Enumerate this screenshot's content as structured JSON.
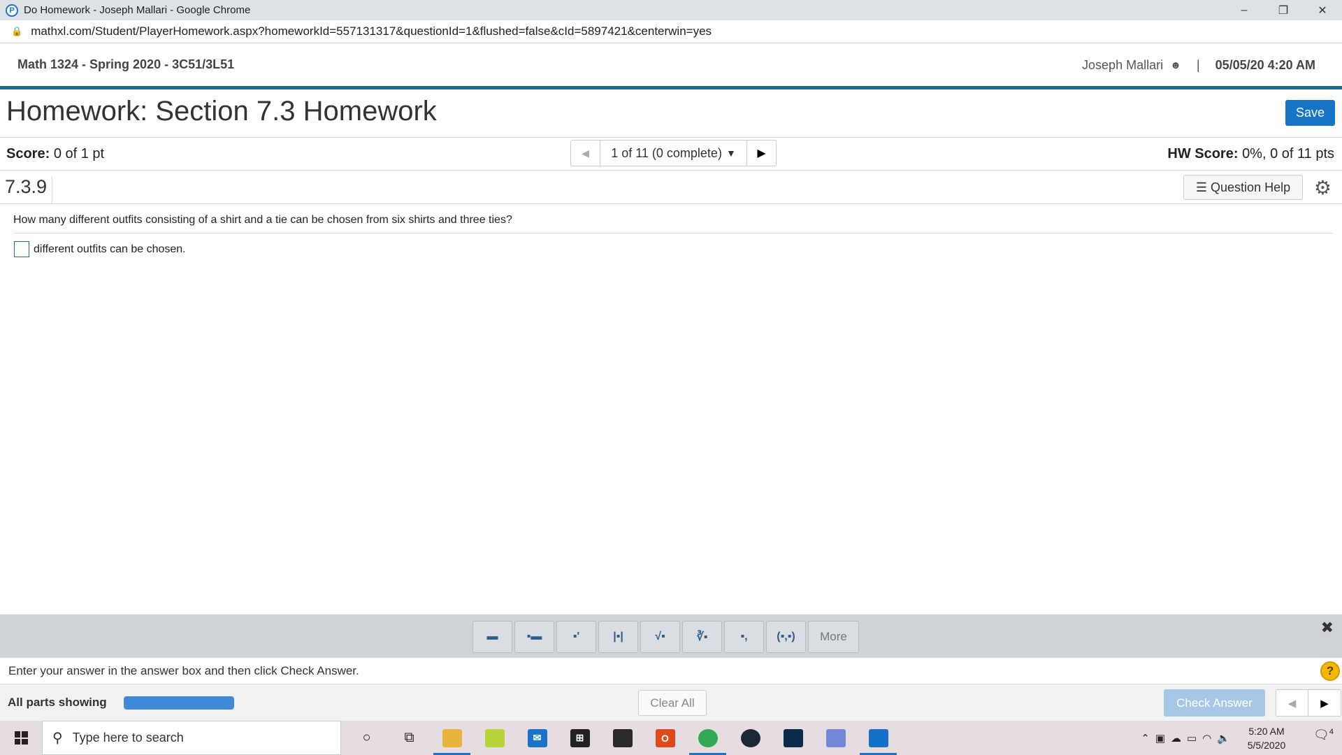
{
  "browser": {
    "window_title": "Do Homework - Joseph Mallari - Google Chrome",
    "url": "mathxl.com/Student/PlayerHomework.aspx?homeworkId=557131317&questionId=1&flushed=false&cId=5897421&centerwin=yes",
    "controls": {
      "minimize": "–",
      "restore": "❐",
      "close": "✕"
    }
  },
  "header": {
    "course": "Math 1324 - Spring 2020 - 3C51/3L51",
    "user": "Joseph Mallari",
    "separator": "|",
    "datetime": "05/05/20 4:20 AM"
  },
  "homework": {
    "title": "Homework: Section 7.3 Homework",
    "save_label": "Save",
    "score_label": "Score:",
    "score_value": "0 of 1 pt",
    "nav_position": "1 of 11 (0 complete)",
    "hw_score_label": "HW Score:",
    "hw_score_value": "0%, 0 of 11 pts",
    "question_id": "7.3.9",
    "help_label": "Question Help"
  },
  "question": {
    "text": "How many different outfits consisting of a shirt and a tie can be chosen from six shirts and three ties?",
    "answer_suffix": "different outfits can be chosen."
  },
  "palette": {
    "tools": [
      "fraction-icon",
      "mixed-number-icon",
      "exponent-icon",
      "absolute-value-icon",
      "sqrt-icon",
      "nth-root-icon",
      "subscript-icon",
      "interval-icon"
    ],
    "glyphs": [
      "▬",
      "▪▬",
      "▪'",
      "|▪|",
      "√▪",
      "∛▪",
      "▪,",
      "(▪,▪)"
    ],
    "more_label": "More"
  },
  "footer": {
    "instruction": "Enter your answer in the answer box and then click Check Answer.",
    "parts_label": "All parts showing",
    "progress_fraction": 1.0,
    "clear_label": "Clear All",
    "check_label": "Check Answer"
  },
  "taskbar": {
    "search_placeholder": "Type here to search",
    "time": "5:20 AM",
    "date": "5/5/2020",
    "notification_count": "4"
  },
  "colors": {
    "accent": "#1775c8",
    "header_border": "#1b6b93",
    "check_disabled": "#a6c8e6",
    "progress": "#3f89d6"
  }
}
